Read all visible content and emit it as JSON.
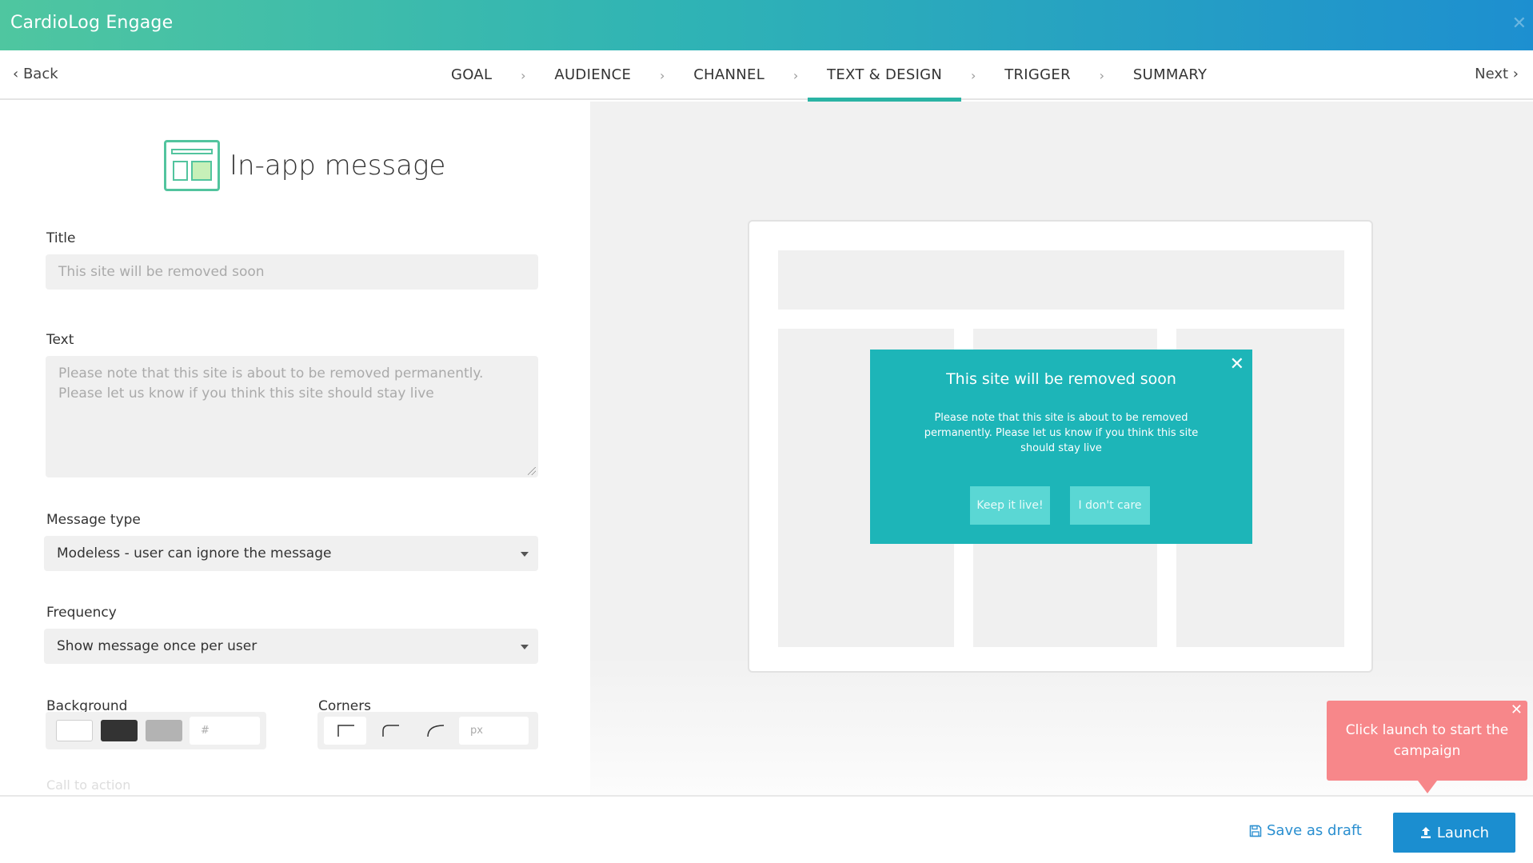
{
  "app": {
    "title": "CardioLog Engage"
  },
  "wizard": {
    "back_label": "Back",
    "next_label": "Next",
    "steps": [
      {
        "label": "GOAL"
      },
      {
        "label": "AUDIENCE"
      },
      {
        "label": "CHANNEL"
      },
      {
        "label": "TEXT & DESIGN",
        "active": true
      },
      {
        "label": "TRIGGER"
      },
      {
        "label": "SUMMARY"
      }
    ]
  },
  "form": {
    "heading": "In-app message",
    "title_label": "Title",
    "title_placeholder": "This site will be removed soon",
    "text_label": "Text",
    "text_placeholder_line1": "Please note that this site is about to be removed permanently.",
    "text_placeholder_line2": "Please let us know if you think this site should stay live",
    "message_type_label": "Message type",
    "message_type_value": "Modeless - user can ignore the message",
    "frequency_label": "Frequency",
    "frequency_value": "Show message once per user",
    "background_label": "Background",
    "background_colors": [
      "#ffffff",
      "#333333",
      "#b3b3b3"
    ],
    "background_hex_placeholder": "#",
    "corners_label": "Corners",
    "corners_px_placeholder": "px",
    "call_to_action_label": "Call to action"
  },
  "preview": {
    "modal_title": "This site will be removed soon",
    "modal_text_line1": "Please note that this site is about to be removed",
    "modal_text_line2": "permanently. Please let us know if you think this site",
    "modal_text_line3": "should stay live",
    "button_keep": "Keep it live!",
    "button_dont_care": "I don't care",
    "modal_color": "#1db5b8"
  },
  "tooltip": {
    "line1": "Click launch to start the",
    "line2": "campaign"
  },
  "footer": {
    "save_draft_label": "Save as draft",
    "launch_label": "Launch"
  },
  "colors": {
    "brand_teal": "#2ab3a4",
    "launch_blue": "#1b8ed0",
    "tooltip_pink": "#f7878a"
  }
}
